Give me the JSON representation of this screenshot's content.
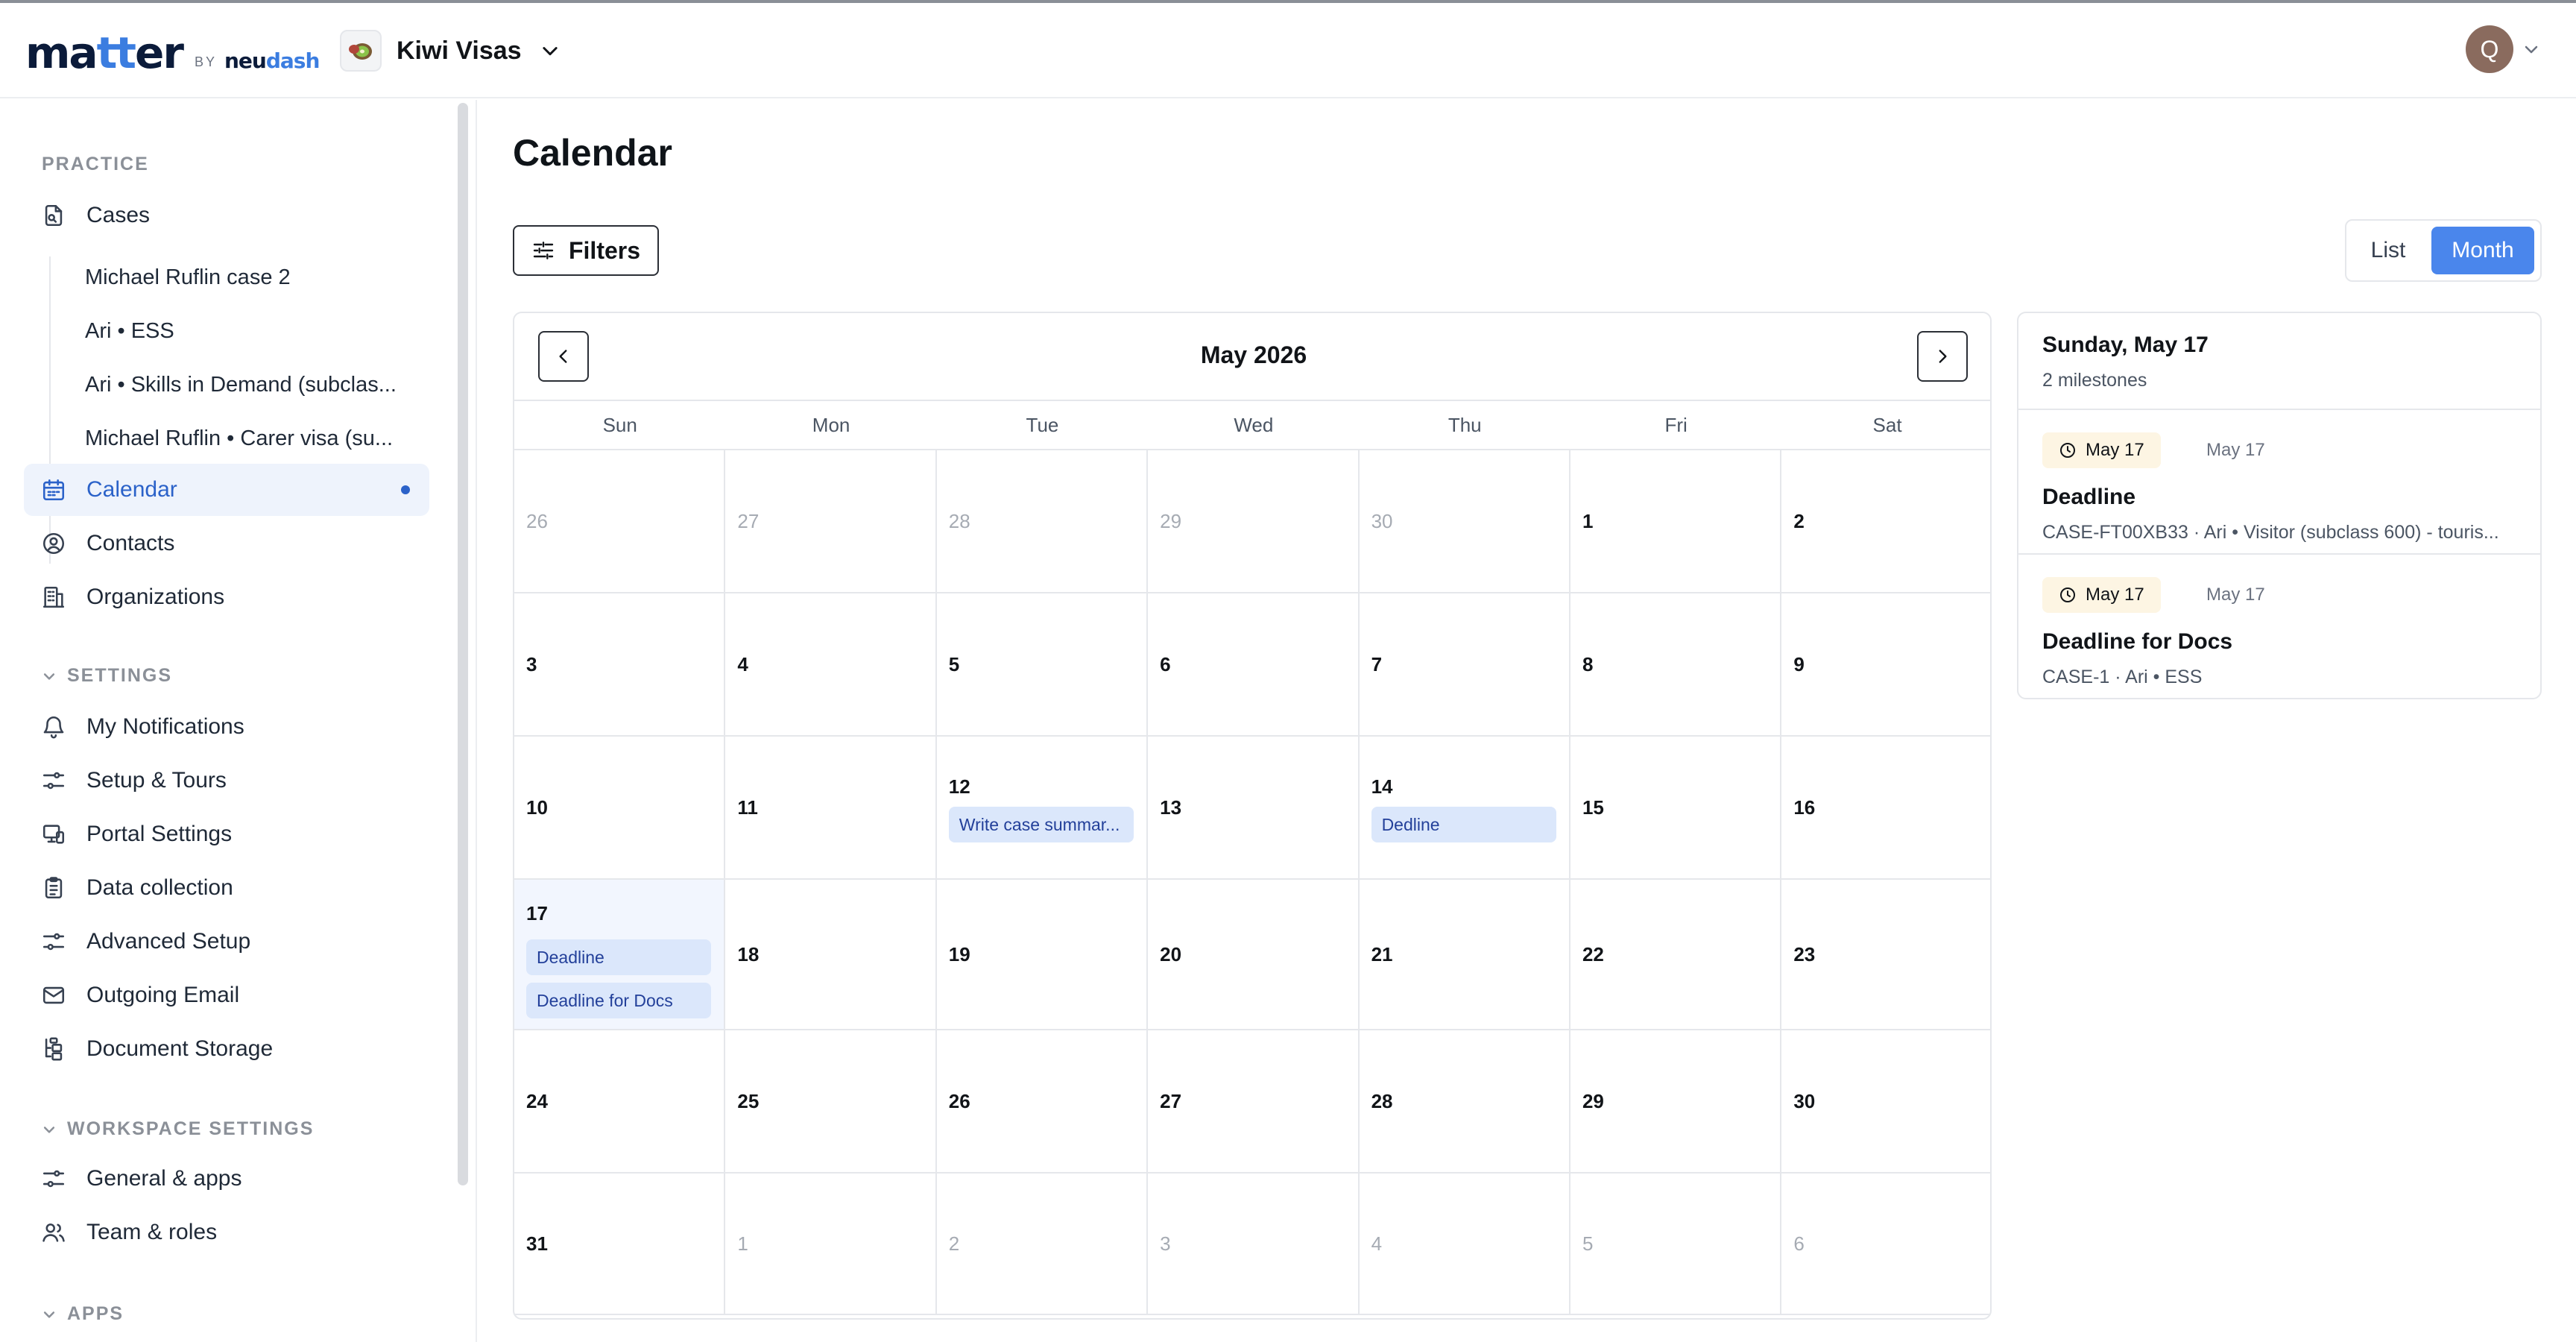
{
  "brand": {
    "name_part1": "ma",
    "name_tt": "tt",
    "name_part2": "er",
    "by": "BY",
    "partner_part1": "neu",
    "partner_part2": "dash"
  },
  "workspace": {
    "name": "Kiwi Visas"
  },
  "user": {
    "initial": "Q"
  },
  "sidebar": {
    "practice_label": "PRACTICE",
    "cases_label": "Cases",
    "case_items": [
      "Michael Ruflin case 2",
      "Ari • ESS",
      "Ari • Skills in Demand (subclas...",
      "Michael Ruflin • Carer visa (su..."
    ],
    "calendar_label": "Calendar",
    "contacts_label": "Contacts",
    "organizations_label": "Organizations",
    "settings_label": "SETTINGS",
    "settings_items": [
      "My Notifications",
      "Setup & Tours",
      "Portal Settings",
      "Data collection",
      "Advanced Setup",
      "Outgoing Email",
      "Document Storage"
    ],
    "workspace_settings_label": "WORKSPACE SETTINGS",
    "workspace_items": [
      "General & apps",
      "Team & roles"
    ],
    "apps_label": "APPS"
  },
  "main": {
    "title": "Calendar",
    "filters_label": "Filters",
    "view_list": "List",
    "view_month": "Month"
  },
  "calendar": {
    "month_label": "May 2026",
    "weekdays": [
      "Sun",
      "Mon",
      "Tue",
      "Wed",
      "Thu",
      "Fri",
      "Sat"
    ],
    "weeks": [
      [
        {
          "d": "26",
          "m": true
        },
        {
          "d": "27",
          "m": true
        },
        {
          "d": "28",
          "m": true
        },
        {
          "d": "29",
          "m": true
        },
        {
          "d": "30",
          "m": true
        },
        {
          "d": "1"
        },
        {
          "d": "2"
        }
      ],
      [
        {
          "d": "3"
        },
        {
          "d": "4"
        },
        {
          "d": "5"
        },
        {
          "d": "6"
        },
        {
          "d": "7"
        },
        {
          "d": "8"
        },
        {
          "d": "9"
        }
      ],
      [
        {
          "d": "10"
        },
        {
          "d": "11"
        },
        {
          "d": "12",
          "events": [
            "Write case summar..."
          ]
        },
        {
          "d": "13"
        },
        {
          "d": "14",
          "events": [
            "Dedline"
          ]
        },
        {
          "d": "15"
        },
        {
          "d": "16"
        }
      ],
      [
        {
          "d": "17",
          "selected": true,
          "events": [
            "Deadline",
            "Deadline for Docs"
          ]
        },
        {
          "d": "18"
        },
        {
          "d": "19"
        },
        {
          "d": "20"
        },
        {
          "d": "21"
        },
        {
          "d": "22"
        },
        {
          "d": "23"
        }
      ],
      [
        {
          "d": "24"
        },
        {
          "d": "25"
        },
        {
          "d": "26"
        },
        {
          "d": "27"
        },
        {
          "d": "28"
        },
        {
          "d": "29"
        },
        {
          "d": "30"
        }
      ],
      [
        {
          "d": "31"
        },
        {
          "d": "1",
          "m": true
        },
        {
          "d": "2",
          "m": true
        },
        {
          "d": "3",
          "m": true
        },
        {
          "d": "4",
          "m": true
        },
        {
          "d": "5",
          "m": true
        },
        {
          "d": "6",
          "m": true
        }
      ]
    ]
  },
  "panel": {
    "title": "Sunday, May 17",
    "subtitle": "2 milestones",
    "milestones": [
      {
        "badge": "May 17",
        "date": "May 17",
        "title": "Deadline",
        "meta": "CASE-FT00XB33 · Ari • Visitor (subclass 600) - touris..."
      },
      {
        "badge": "May 17",
        "date": "May 17",
        "title": "Deadline for Docs",
        "meta": "CASE-1 · Ari • ESS"
      }
    ]
  },
  "colors": {
    "accent": "#4a86ec",
    "active_bg": "#eef3fc",
    "event_bg": "#dbe7fb",
    "badge_bg": "#fdf5e3"
  },
  "icons": [
    "cases-icon",
    "calendar-icon",
    "contacts-icon",
    "organizations-icon",
    "bell-icon",
    "sliders-icon",
    "portal-icon",
    "clipboard-icon",
    "mail-icon",
    "storage-icon",
    "team-icon",
    "clock-icon",
    "chevron-left-icon",
    "chevron-right-icon",
    "chevron-down-icon",
    "filter-icon"
  ]
}
